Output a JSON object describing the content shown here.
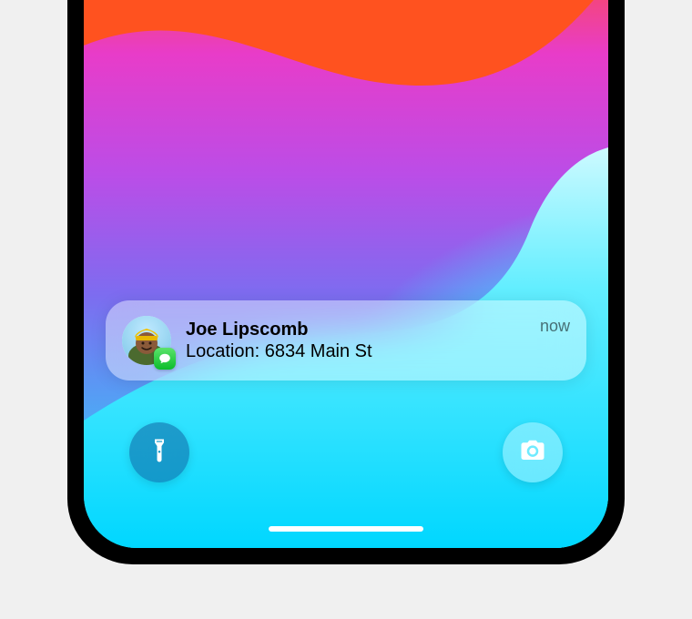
{
  "notification": {
    "sender": "Joe Lipscomb",
    "body": "Location: 6834 Main St",
    "time": "now",
    "app_icon": "messages-icon",
    "avatar_desc": "person-yellow-beanie"
  },
  "quick_actions": {
    "left": "flashlight-icon",
    "right": "camera-icon"
  },
  "colors": {
    "messages_green": "#0bbd2a",
    "indicator": "#ffffff"
  }
}
